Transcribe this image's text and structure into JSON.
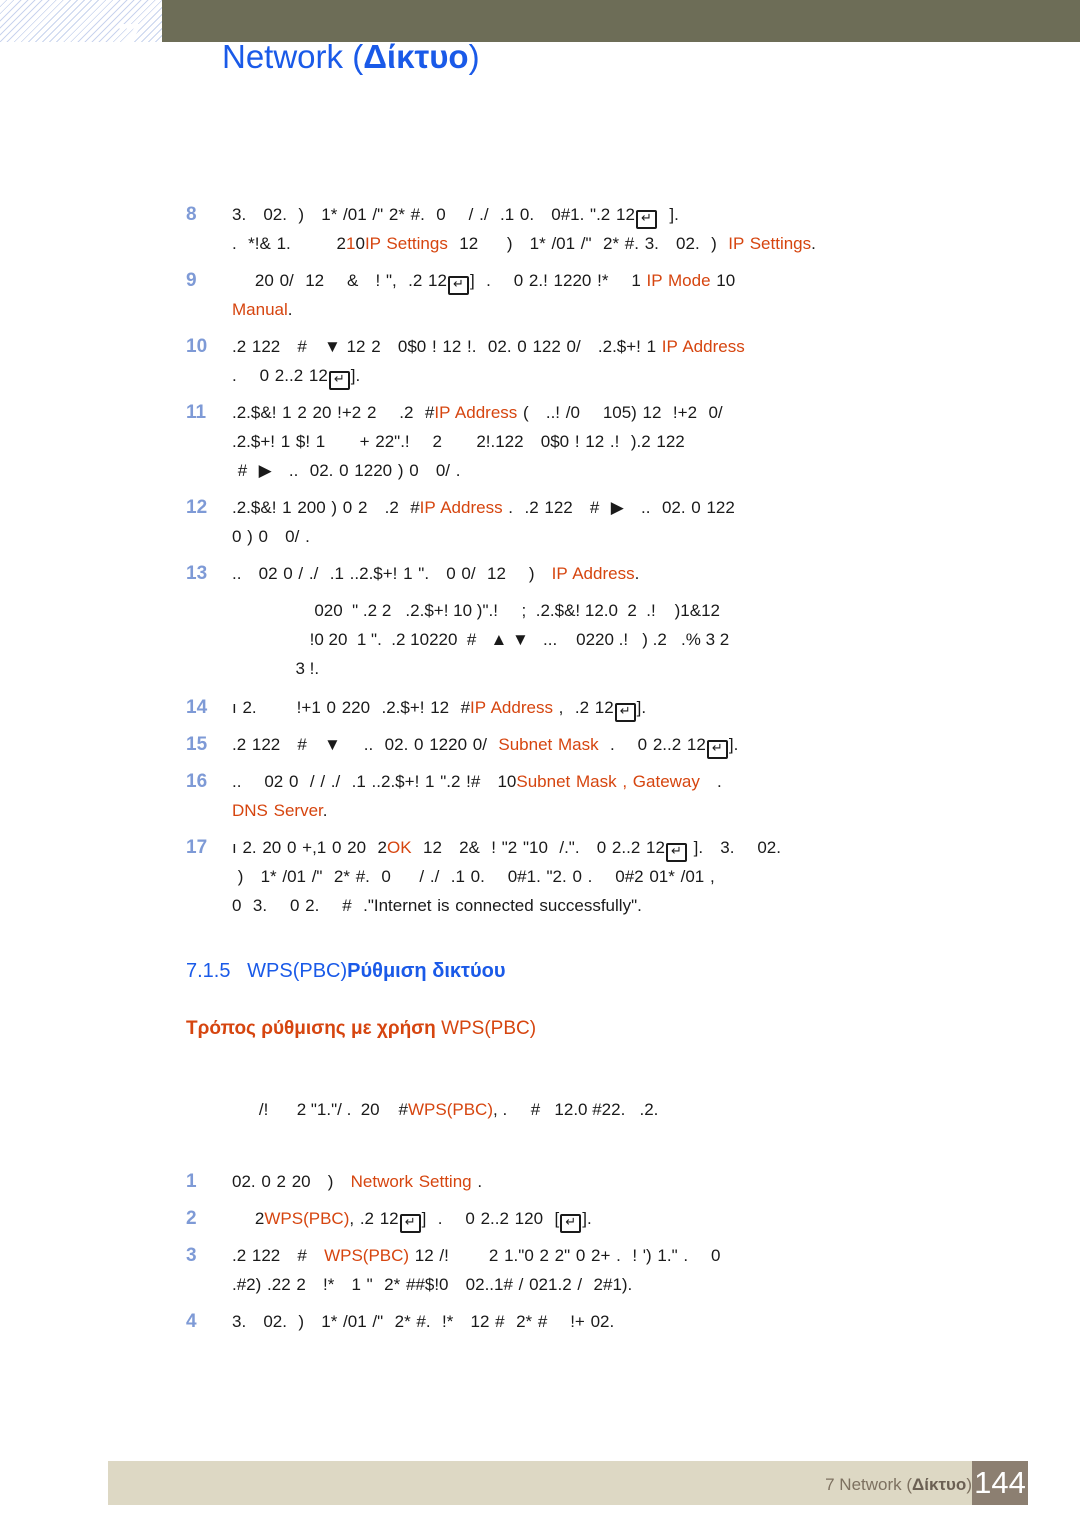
{
  "header": {
    "chapter_marker": "7",
    "title_en": "Network (",
    "title_el": "Δίκτυο",
    "title_close": ")",
    "bar_color": "#6d6d57",
    "title_color": "#1a5ae8"
  },
  "colors": {
    "accent_blue": "#1a5ae8",
    "highlight_orange": "#d6450f",
    "step_number_blue": "#7e9ad6",
    "footer_bar": "#ddd8c4",
    "page_box": "#8c7f71"
  },
  "steps": [
    {
      "num": "8",
      "lines": [
        [
          {
            "t": "3.   02.  )   1* /01 /\" 2* #.  0    / ./  .1 0.   0#1. \".2 12"
          },
          {
            "key": "↵"
          },
          {
            "t": "  ]."
          }
        ],
        [
          {
            "t": ".  *!& 1.        2"
          },
          {
            "t": "1",
            "hl": true
          },
          {
            "t": "0",
            "hl": false
          },
          {
            "t": "IP Settings",
            "hl": true
          },
          {
            "t": "  12     )   1* /01 /\"  2* #. 3.   02.  )  "
          },
          {
            "t": "IP Settings",
            "hl": true
          },
          {
            "t": "."
          }
        ]
      ]
    },
    {
      "num": "9",
      "lines": [
        [
          {
            "t": "    2"
          },
          {
            "t": "0",
            "hl": false
          },
          {
            "t": " 0/  12    &   ! \",  .2 12"
          },
          {
            "key": "↵"
          },
          {
            "t": "]  .    0 2.! 122"
          },
          {
            "t": "0 !*    1 ",
            "hl": false
          },
          {
            "t": "IP Mode",
            "hl": true
          },
          {
            "t": " 10"
          }
        ],
        [
          {
            "t": "Manual",
            "hl": true
          },
          {
            "t": "."
          }
        ]
      ]
    },
    {
      "num": "10",
      "lines": [
        [
          {
            "t": ".2 122   #   ▼ 12 2   0$0 ! 12 !.  02. 0 122 0/   .2.$+! 1 "
          },
          {
            "t": "IP Address",
            "hl": true
          }
        ],
        [
          {
            "t": ".    0 2..2 12"
          },
          {
            "key": "↵"
          },
          {
            "t": "]."
          }
        ]
      ]
    },
    {
      "num": "11",
      "lines": [
        [
          {
            "t": ".2.$&! 1 2 20 !+2 2    .2  #"
          },
          {
            "t": "IP Address",
            "hl": true
          },
          {
            "t": " (   ..! /0    105) 12  !+2  0/"
          }
        ],
        [
          {
            "t": ".2.$+! 1 $! 1      + 22\".!    2      2!.122   0$0 ! 12 .!  ).2 122"
          }
        ],
        [
          {
            "t": " #  ▶   ..  02. 0 1220 ) 0   0/ ."
          }
        ]
      ]
    },
    {
      "num": "12",
      "lines": [
        [
          {
            "t": ".2.$&! 1 200 ) 0 2   .2  #"
          },
          {
            "t": "IP Address",
            "hl": true
          },
          {
            "t": " .  .2 122   #  ▶   ..  02. 0 122"
          }
        ],
        [
          {
            "t": "0 ) 0   0/ ."
          }
        ]
      ]
    },
    {
      "num": "13",
      "lines": [
        [
          {
            "t": "..   02 0 / ./  .1 ..2.$+! 1 \".   0 0/  12    )   "
          },
          {
            "t": "IP Address",
            "hl": true
          },
          {
            "t": "."
          }
        ]
      ]
    }
  ],
  "note_block": [
    "      020  \" .2 2   .2.$+! 10 )\".!     ;  .2.$&! 12.0  2  .!    )1&12",
    "     !0 20  1 \".  .2 10220  #   ▲ ▼   ...    0220 .!   ) .2   .% 3 2",
    "  3 !."
  ],
  "steps2": [
    {
      "num": "14",
      "lines": [
        [
          {
            "t": "ı 2.       !+1 0 220  .2.$+! 12  #"
          },
          {
            "t": "IP Address",
            "hl": true
          },
          {
            "t": " ,  .2 12"
          },
          {
            "key": "↵"
          },
          {
            "t": "]."
          }
        ]
      ]
    },
    {
      "num": "15",
      "lines": [
        [
          {
            "t": ".2 122   #   ▼    ..  02. 0 1220 0/  "
          },
          {
            "t": "Subnet Mask",
            "hl": true
          },
          {
            "t": "  .    0 2..2 12"
          },
          {
            "key": "↵"
          },
          {
            "t": "]."
          }
        ]
      ]
    },
    {
      "num": "16",
      "lines": [
        [
          {
            "t": "..    02 0  / / ./  .1 ..2.$+! 1 \".2 !#   10"
          },
          {
            "t": "Subnet Mask",
            "hl": true
          },
          {
            "t": " , ",
            "hl": true
          },
          {
            "t": "Gateway",
            "hl": true
          },
          {
            "t": "   ."
          }
        ],
        [
          {
            "t": "DNS Server",
            "hl": true
          },
          {
            "t": "."
          }
        ]
      ]
    },
    {
      "num": "17",
      "lines": [
        [
          {
            "t": "ı 2. 20 0 +,1 0 20  2"
          },
          {
            "t": "OK",
            "hl": true
          },
          {
            "t": "  12   2&  ! \"2 \"10  /.\".   0 2..2 12"
          },
          {
            "key": "↵"
          },
          {
            "t": " ].   3.    02."
          }
        ],
        [
          {
            "t": " )   1* /01 /\"  2* #.  0     / ./  .1 0.    0#1. \"2. 0 .    0#2 01* /01 ,"
          }
        ],
        [
          {
            "t": "0  3.    0 2.    #  .\"Internet is connected successfully\"."
          }
        ]
      ]
    }
  ],
  "section": {
    "number": "7.1.5",
    "title_en": "WPS(PBC)",
    "title_el": "Ρύθμιση δικτύου"
  },
  "subsection": {
    "title_el": "Τρόπος ρύθμισης με χρήση ",
    "title_en": "WPS(PBC)"
  },
  "lead_note": {
    "pre": "/!      2 \"1.\"/ .  20    #",
    "hl": "WPS(PBC)",
    "post": ", .     #   12.0 #22.   .2."
  },
  "steps3": [
    {
      "num": "1",
      "lines": [
        [
          {
            "t": "02. 0 2 20   )   "
          },
          {
            "t": "Network Setting",
            "hl": true
          },
          {
            "t": " ."
          }
        ]
      ]
    },
    {
      "num": "2",
      "lines": [
        [
          {
            "t": "    2"
          },
          {
            "t": "WPS(PBC)",
            "hl": true
          },
          {
            "t": ", .2 12"
          },
          {
            "key": "↵"
          },
          {
            "t": "]  .    0 2..2 120  ["
          },
          {
            "key": "↵"
          },
          {
            "t": "]."
          }
        ]
      ]
    },
    {
      "num": "3",
      "lines": [
        [
          {
            "t": ".2 122   #   "
          },
          {
            "t": "WPS(PBC)",
            "hl": true
          },
          {
            "t": " 12 /!       2 1.\"0 2 2\" 0 2+ .  ! ') 1.\" .    0"
          }
        ],
        [
          {
            "t": ".#2) .22 2   !*   1 \"  2* ##$!0   02..1# / 021.2 /  2#1)."
          }
        ]
      ]
    },
    {
      "num": "4",
      "lines": [
        [
          {
            "t": "3.   02.  )   1* /01 /\"  2* #.  !*   12 #  2* #    !+ 02."
          }
        ]
      ]
    }
  ],
  "footer": {
    "chapter": "7 Network (",
    "chapter_el": "Δίκτυο",
    "chapter_close": ")",
    "page_number": "144"
  }
}
